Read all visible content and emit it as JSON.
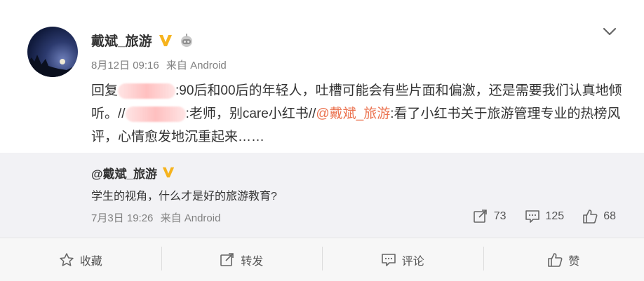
{
  "post": {
    "username": "戴斌_旅游",
    "date": "8月12日 09:16",
    "source": "来自 Android",
    "content": {
      "reply_prefix": "回复",
      "part1": ":90后和00后的年轻人，吐槽可能会有些片面和偏激，还是需要我们认真地倾听。//",
      "part2": ":老师，别care小红书//",
      "mention": "@戴斌_旅游",
      "part3": ":看了小红书关于旅游管理专业的热榜风评，心情愈发地沉重起来……"
    }
  },
  "quoted": {
    "username": "@戴斌_旅游",
    "text": "学生的视角，什么才是好的旅游教育?",
    "date": "7月3日 19:26",
    "source": "来自 Android",
    "reposts": "73",
    "comments": "125",
    "likes": "68"
  },
  "actions": {
    "favorite": "收藏",
    "repost": "转发",
    "comment": "评论",
    "like": "赞"
  },
  "colors": {
    "mention": "#eb7350",
    "verified_badge": "#f6b31d",
    "quote_bg": "#f2f2f5"
  },
  "icons": {
    "verified": "verified-badge-icon",
    "robot": "robot-icon",
    "chevron": "chevron-down-icon",
    "repost": "repost-icon",
    "comment": "comment-icon",
    "like": "thumbs-up-icon",
    "favorite": "star-icon"
  }
}
